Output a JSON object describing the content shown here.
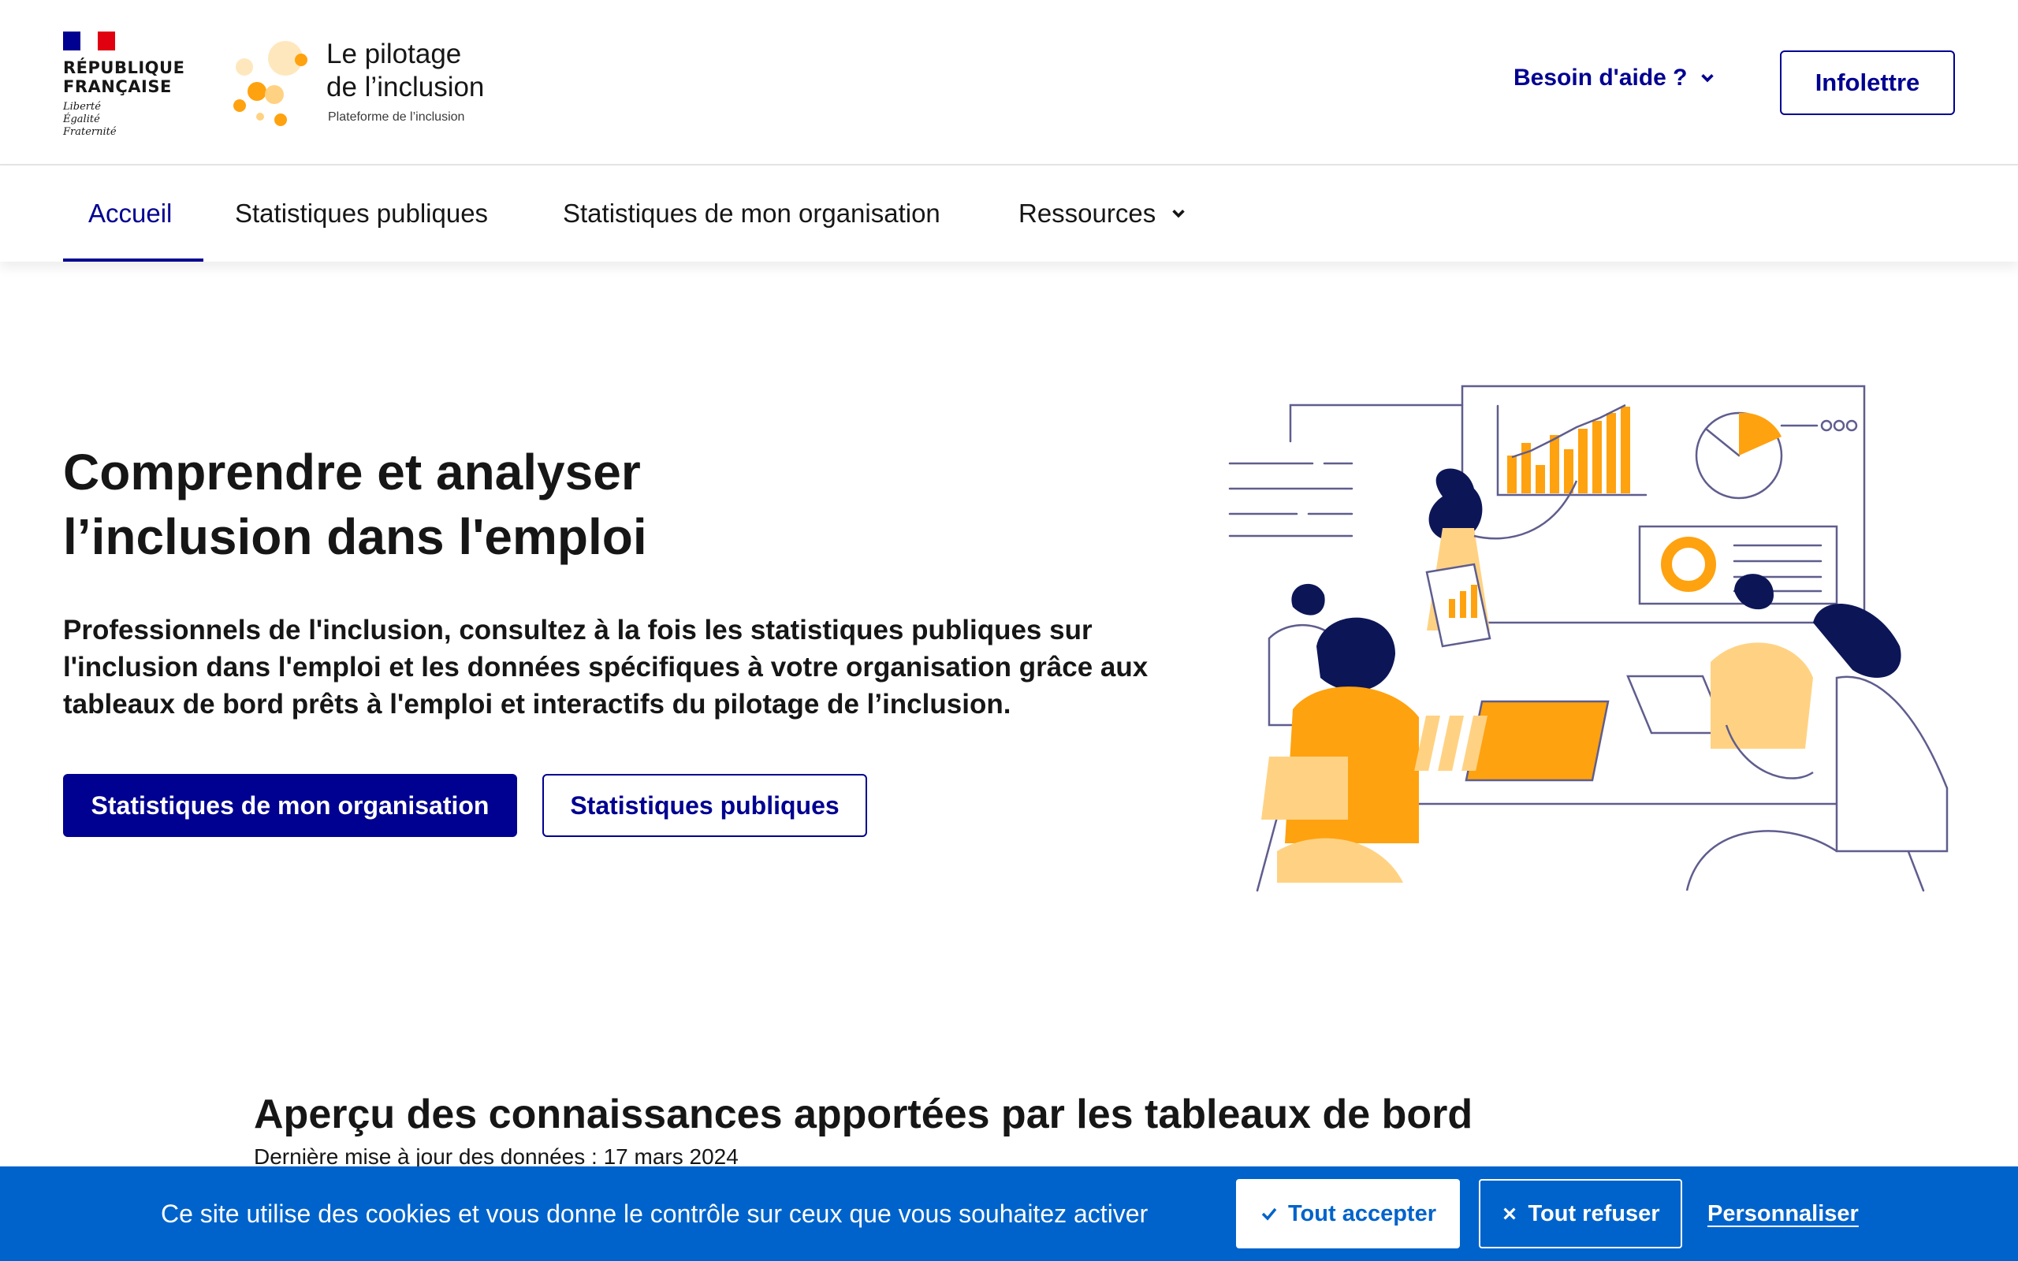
{
  "header": {
    "republic_name": "RÉPUBLIQUE\nFRANÇAISE",
    "republic_motto": "Liberté\nÉgalité\nFraternité",
    "brand_title": "Le pilotage\nde l’inclusion",
    "brand_subtitle": "Plateforme de l’inclusion",
    "help_label": "Besoin d'aide ?",
    "newsletter_label": "Infolettre"
  },
  "nav": {
    "items": [
      {
        "label": "Accueil",
        "active": true
      },
      {
        "label": "Statistiques publiques"
      },
      {
        "label": "Statistiques de mon organisation"
      },
      {
        "label": "Ressources"
      }
    ]
  },
  "hero": {
    "title_line1": "Comprendre et analyser",
    "title_line2": "l’inclusion dans l'emploi",
    "text": "Professionnels de l'inclusion, consultez à la fois les statistiques publiques sur l'inclusion dans l'emploi et les données spécifiques à votre organisation grâce aux tableaux de bord prêts à l'emploi et interactifs du pilotage de l’inclusion.",
    "primary_button": "Statistiques de mon organisation",
    "secondary_button": "Statistiques publiques"
  },
  "section": {
    "title": "Aperçu des connaissances apportées par les tableaux de bord",
    "subtitle": "Dernière mise à jour des données : 17 mars 2024"
  },
  "cookie": {
    "text": "Ce site utilise des cookies et vous donne le contrôle sur ceux que vous souhaitez activer",
    "accept_label": "Tout accepter",
    "refuse_label": "Tout refuser",
    "customize_label": "Personnaliser"
  },
  "colors": {
    "primary": "#000091",
    "cookie_banner": "#0063cb",
    "accent_yellow": "#ffa20f",
    "light_yellow": "#ffd283",
    "illustration_line": "#5f5d8e",
    "illustration_dark": "#0c1657"
  },
  "icons": {
    "help_chevron": "chevron-down-icon",
    "resources_chevron": "chevron-down-icon",
    "accept": "check-icon",
    "refuse": "close-icon"
  }
}
